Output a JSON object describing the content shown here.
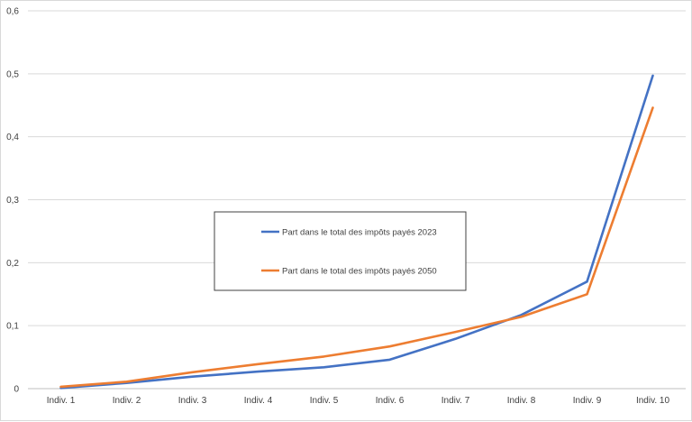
{
  "chart_data": {
    "type": "line",
    "categories": [
      "Indiv. 1",
      "Indiv. 2",
      "Indiv. 3",
      "Indiv. 4",
      "Indiv. 5",
      "Indiv. 6",
      "Indiv. 7",
      "Indiv. 8",
      "Indiv. 9",
      "Indiv. 10"
    ],
    "series": [
      {
        "name": "Part dans le total des impôts payés 2023",
        "color": "#4472C4",
        "values": [
          0.001,
          0.009,
          0.019,
          0.027,
          0.034,
          0.046,
          0.079,
          0.117,
          0.17,
          0.497
        ]
      },
      {
        "name": "Part dans le total des impôts payés 2050",
        "color": "#ED7D31",
        "values": [
          0.003,
          0.011,
          0.026,
          0.039,
          0.051,
          0.067,
          0.09,
          0.114,
          0.15,
          0.446
        ]
      }
    ],
    "yticks": [
      "0",
      "0,1",
      "0,2",
      "0,3",
      "0,4",
      "0,5",
      "0,6"
    ],
    "ylim": [
      0,
      0.6
    ],
    "grid": true,
    "legend": "center"
  }
}
